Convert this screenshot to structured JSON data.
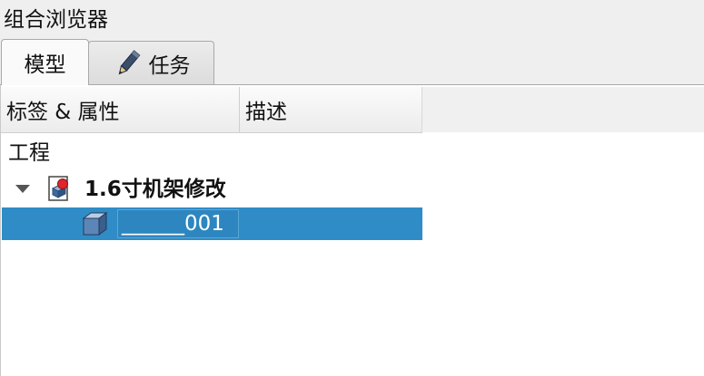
{
  "panel": {
    "title": "组合浏览器"
  },
  "tabs": [
    {
      "label": "模型",
      "active": true
    },
    {
      "label": "任务",
      "active": false,
      "icon": "pencil-icon"
    }
  ],
  "tree": {
    "columns": [
      "标签 & 属性",
      "描述"
    ],
    "group_label": "工程",
    "document": {
      "label": "1.6寸机架修改",
      "icon": "document-icon",
      "expanded": true
    },
    "selected_item": {
      "value": "______001",
      "icon": "part-box-icon"
    }
  },
  "colors": {
    "selection": "#308cc6",
    "selection_text": "#ffffff"
  }
}
